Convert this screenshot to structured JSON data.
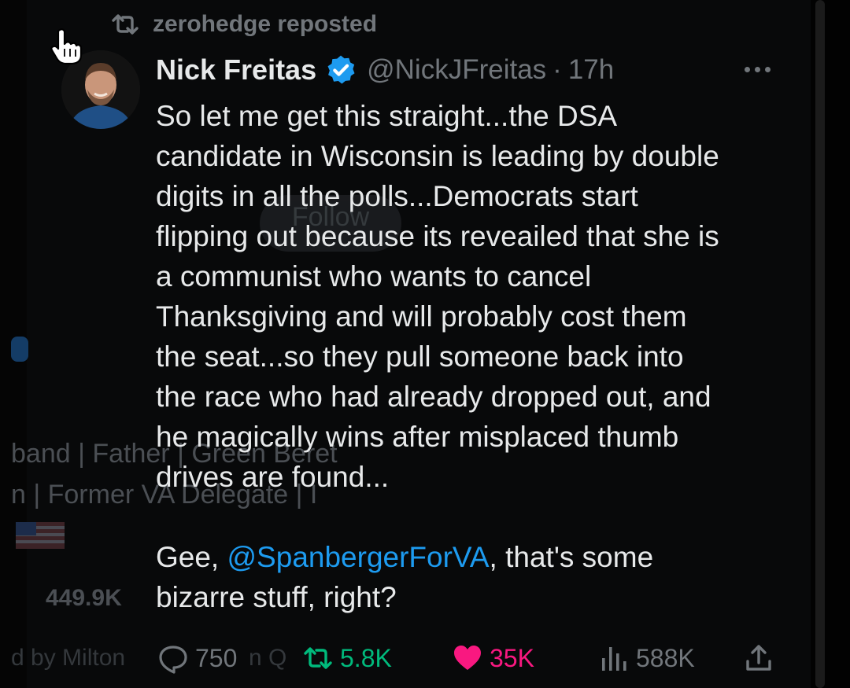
{
  "repost": {
    "text": "zerohedge reposted",
    "icon": "repost-icon"
  },
  "author": {
    "display_name": "Nick Freitas",
    "handle": "@NickJFreitas",
    "separator": "·",
    "time": "17h",
    "verified": true
  },
  "tweet": {
    "paragraph1": [
      "So let me get this straight...the DSA",
      "candidate in Wisconsin is leading by double",
      "digits in all the polls...Democrats start",
      "flipping out because its reveailed that she is",
      "a communist who wants to cancel",
      "Thanksgiving and will probably cost them",
      "the seat...so they pull someone back into",
      "the race who had already dropped out, and",
      "he magically wins after misplaced thumb",
      "drives are found..."
    ],
    "paragraph2_line1_prefix": "Gee, ",
    "mention": "@SpanbergerForVA",
    "paragraph2_line1_suffix": ", that's some",
    "paragraph2_line2": "bizarre stuff, right?"
  },
  "actions": {
    "replies": "750",
    "reposts": "5.8K",
    "likes": "35K",
    "views": "588K"
  },
  "ghost": {
    "follow": "Follow",
    "bio1": "band | Father | Green Beret",
    "bio2": "n | Former VA Delegate | I",
    "followers": "449.9K",
    "followed_by": "d by Milton",
    "followed_by2": "n Q"
  },
  "colors": {
    "accent": "#1d9bf0",
    "repost": "#00ba7c",
    "like": "#f91880",
    "muted": "#71767b"
  }
}
